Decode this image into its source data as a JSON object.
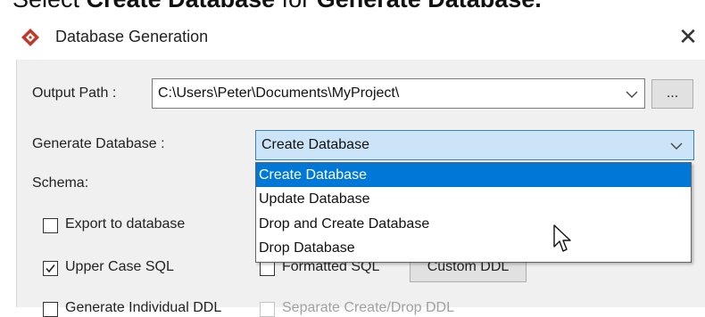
{
  "caption": {
    "prefix": "Select ",
    "option": "Create Database",
    "middle": " for ",
    "field": "Generate Database."
  },
  "window": {
    "title": "Database Generation",
    "close_glyph": "✕",
    "app_icon": "vp-logo-icon"
  },
  "output_path": {
    "label": "Output Path :",
    "value": "C:\\Users\\Peter\\Documents\\MyProject\\",
    "browse_label": "..."
  },
  "generate_database": {
    "label": "Generate Database :",
    "selected": "Create Database",
    "options": [
      "Create Database",
      "Update Database",
      "Drop and Create Database",
      "Drop Database"
    ],
    "highlighted_index": 0
  },
  "schema": {
    "label": "Schema:"
  },
  "options": {
    "export_to_database": {
      "label": "Export to database",
      "checked": false
    },
    "upper_case_sql": {
      "label": "Upper Case SQL",
      "checked": true
    },
    "formatted_sql": {
      "label": "Formatted SQL",
      "checked": false
    },
    "custom_ddl_label": "Custom DDL",
    "generate_individual_ddl": {
      "label": "Generate Individual DDL",
      "checked": false
    },
    "separate_create_drop_ddl": {
      "label": "Separate Create/Drop DDL",
      "checked": false,
      "disabled": true
    }
  },
  "colors": {
    "accent": "#0078d7",
    "combo_focus_bg": "#cce4f7",
    "dialog_bg": "#f0f0f0",
    "app_icon": "#c0392b"
  }
}
